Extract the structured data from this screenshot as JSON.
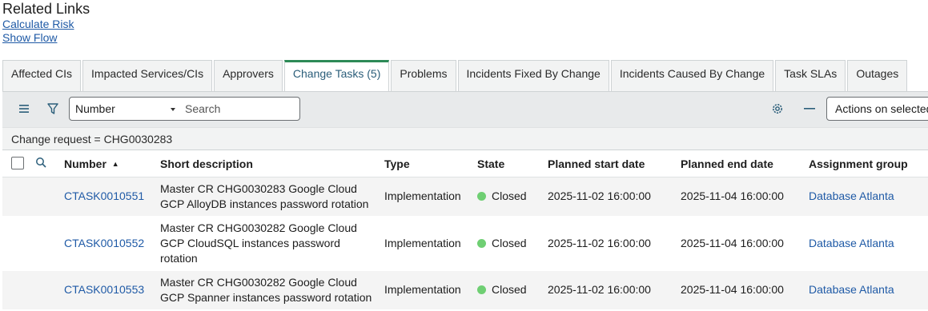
{
  "related": {
    "heading": "Related Links",
    "links": [
      "Calculate Risk",
      "Show Flow"
    ]
  },
  "tabs": [
    {
      "label": "Affected CIs",
      "active": false
    },
    {
      "label": "Impacted Services/CIs",
      "active": false
    },
    {
      "label": "Approvers",
      "active": false
    },
    {
      "label": "Change Tasks (5)",
      "active": true
    },
    {
      "label": "Problems",
      "active": false
    },
    {
      "label": "Incidents Fixed By Change",
      "active": false
    },
    {
      "label": "Incidents Caused By Change",
      "active": false
    },
    {
      "label": "Task SLAs",
      "active": false
    },
    {
      "label": "Outages",
      "active": false
    }
  ],
  "toolbar": {
    "field_select": "Number",
    "search_placeholder": "Search",
    "actions_label": "Actions on selected rows..."
  },
  "filter": {
    "text": "Change request = CHG0030283"
  },
  "columns": {
    "number": "Number",
    "short_description": "Short description",
    "type": "Type",
    "state": "State",
    "planned_start": "Planned start date",
    "planned_end": "Planned end date",
    "assignment_group": "Assignment group"
  },
  "rows": [
    {
      "number": "CTASK0010551",
      "short_description": "Master CR CHG0030283 Google Cloud GCP AlloyDB instances password rotation",
      "type": "Implementation",
      "state": "Closed",
      "planned_start": "2025-11-02 16:00:00",
      "planned_end": "2025-11-04 16:00:00",
      "assignment_group": "Database Atlanta"
    },
    {
      "number": "CTASK0010552",
      "short_description": "Master CR CHG0030282 Google Cloud GCP CloudSQL instances password rotation",
      "type": "Implementation",
      "state": "Closed",
      "planned_start": "2025-11-02 16:00:00",
      "planned_end": "2025-11-04 16:00:00",
      "assignment_group": "Database Atlanta"
    },
    {
      "number": "CTASK0010553",
      "short_description": "Master CR CHG0030282 Google Cloud GCP Spanner instances password rotation",
      "type": "Implementation",
      "state": "Closed",
      "planned_start": "2025-11-02 16:00:00",
      "planned_end": "2025-11-04 16:00:00",
      "assignment_group": "Database Atlanta"
    }
  ],
  "colors": {
    "state_closed": "#6fcf73",
    "link": "#1f5aa6",
    "active_tab_accent": "#2d8a57"
  }
}
